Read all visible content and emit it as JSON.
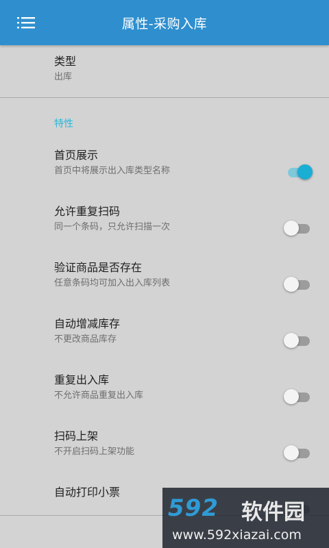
{
  "header": {
    "title": "属性-采购入库",
    "menu_icon": "hamburger-menu-icon",
    "background_color": "#2f8fce"
  },
  "type_row": {
    "title": "类型",
    "value": "出库"
  },
  "section": {
    "header": "特性",
    "accent_color": "#2bb7d6"
  },
  "settings": [
    {
      "title": "首页展示",
      "subtitle": "首页中将展示出入库类型名称",
      "enabled": true
    },
    {
      "title": "允许重复扫码",
      "subtitle": "同一个条码，只允许扫描一次",
      "enabled": false
    },
    {
      "title": "验证商品是否存在",
      "subtitle": "任意条码均可加入出入库列表",
      "enabled": false
    },
    {
      "title": "自动增减库存",
      "subtitle": "不更改商品库存",
      "enabled": false
    },
    {
      "title": "重复出入库",
      "subtitle": "不允许商品重复出入库",
      "enabled": false
    },
    {
      "title": "扫码上架",
      "subtitle": "不开启扫码上架功能",
      "enabled": false
    },
    {
      "title": "自动打印小票",
      "subtitle": "",
      "enabled": false
    }
  ],
  "watermark": {
    "logo": "592",
    "name": "软件园",
    "url": "www.592xiazai.com"
  }
}
